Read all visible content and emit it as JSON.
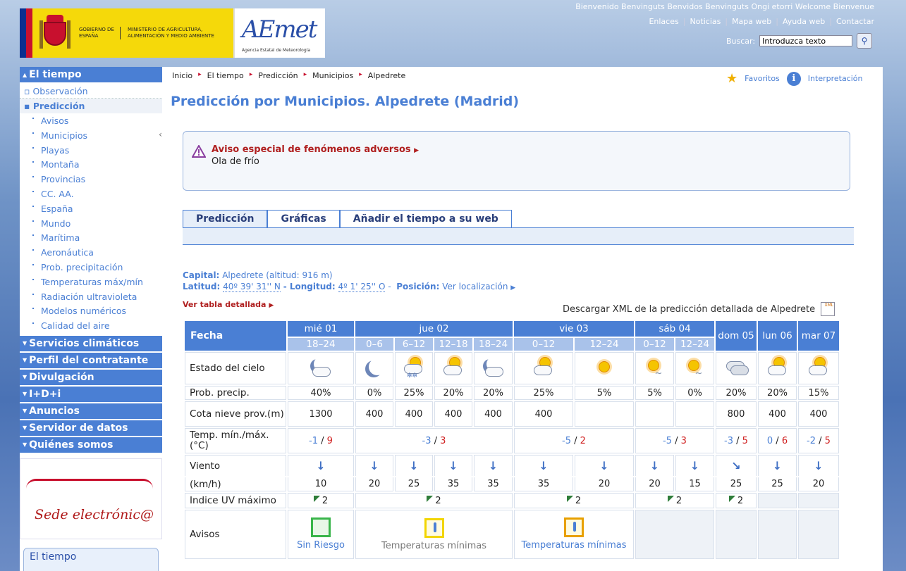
{
  "header": {
    "ministry_left": "GOBIERNO DE ESPAÑA",
    "ministry_right": "MINISTERIO DE AGRICULTURA, ALIMENTACIÓN Y MEDIO AMBIENTE",
    "brand": "AEmet",
    "brand_sub": "Agencia Estatal de Meteorología",
    "welcome": "Bienvenido Benvinguts Benvidos Benvinguts Ongi etorri Welcome Bienvenue",
    "links": [
      "Enlaces",
      "Noticias",
      "Mapa web",
      "Ayuda web",
      "Contactar"
    ],
    "search_label": "Buscar:",
    "search_value": "Introduzca texto"
  },
  "sidebar": {
    "el_tiempo": "El tiempo",
    "observacion": "Observación",
    "prediccion": "Predicción",
    "leaves": [
      "Avisos",
      "Municipios",
      "Playas",
      "Montaña",
      "Provincias",
      "CC. AA.",
      "España",
      "Mundo",
      "Marítima",
      "Aeronáutica",
      "Prob. precipitación",
      "Temperaturas máx/mín",
      "Radiación ultravioleta",
      "Modelos numéricos",
      "Calidad del aire"
    ],
    "sections": [
      "Servicios climáticos",
      "Perfil del contratante",
      "Divulgación",
      "I+D+i",
      "Anuncios",
      "Servidor de datos",
      "Quiénes somos"
    ],
    "sede": "Sede electrónic@",
    "box_title": "El tiempo"
  },
  "breadcrumb": [
    "Inicio",
    "El tiempo",
    "Predicción",
    "Municipios",
    "Alpedrete"
  ],
  "favoritos": "Favoritos",
  "interpretacion": "Interpretación",
  "title": "Predicción por Municipios. Alpedrete (Madrid)",
  "alert": {
    "title": "Aviso especial de fenómenos adversos",
    "text": "Ola de frío"
  },
  "tabs": [
    "Predicción",
    "Gráficas",
    "Añadir el tiempo a su web"
  ],
  "location": {
    "capital_label": "Capital:",
    "capital_value": "Alpedrete (altitud: 916 m)",
    "lat_label": "Latitud:",
    "lat_value": "40º 39' 31'' N",
    "lon_label": "- Longitud:",
    "lon_value": "4º 1' 25'' O",
    "pos_label": "Posición:",
    "pos_value": "Ver localización"
  },
  "ver_tabla": "Ver tabla detallada",
  "xml_text": "Descargar XML de la predicción detallada de Alpedrete",
  "xml_icon": "XML",
  "table": {
    "fecha_label": "Fecha",
    "days": [
      "mié 01",
      "jue 02",
      "vie 03",
      "sáb 04",
      "dom 05",
      "lun 06",
      "mar 07"
    ],
    "periods": [
      "18–24",
      "0–6",
      "6–12",
      "12–18",
      "18–24",
      "0–12",
      "12–24",
      "0–12",
      "12–24"
    ],
    "rows": {
      "estado": "Estado del cielo",
      "prob": "Prob. precip.",
      "cota": "Cota nieve prov.(m)",
      "temp": "Temp. mín./máx. (°C)",
      "viento": "Viento",
      "kmh": "(km/h)",
      "uv": "Indice UV máximo",
      "avisos": "Avisos"
    },
    "prob": [
      "40%",
      "0%",
      "25%",
      "20%",
      "20%",
      "25%",
      "5%",
      "5%",
      "0%",
      "20%",
      "20%",
      "15%"
    ],
    "cota": [
      "1300",
      "400",
      "400",
      "400",
      "400",
      "400",
      "",
      "",
      "",
      "800",
      "400",
      "400"
    ],
    "temp_min": [
      "-1",
      "-3",
      "-5",
      "-5",
      "-3",
      "0",
      "-2"
    ],
    "temp_max": [
      "9",
      "3",
      "2",
      "3",
      "5",
      "6",
      "5"
    ],
    "temp_sep": "/",
    "kmh": [
      "10",
      "20",
      "25",
      "35",
      "35",
      "35",
      "20",
      "20",
      "15",
      "25",
      "25",
      "20"
    ],
    "uv": [
      "2",
      "2",
      "2",
      "2",
      "2"
    ],
    "avisos": {
      "sin_riesgo": "Sin Riesgo",
      "temp_min": "Temperaturas mínimas",
      "temp_min2": "Temperaturas mínimas"
    }
  },
  "icons": [
    "search-icon",
    "star-icon",
    "info-icon",
    "warning-icon",
    "xml-icon"
  ],
  "colors": {
    "accent": "#4a7fd4",
    "alert_red": "#b02020"
  }
}
